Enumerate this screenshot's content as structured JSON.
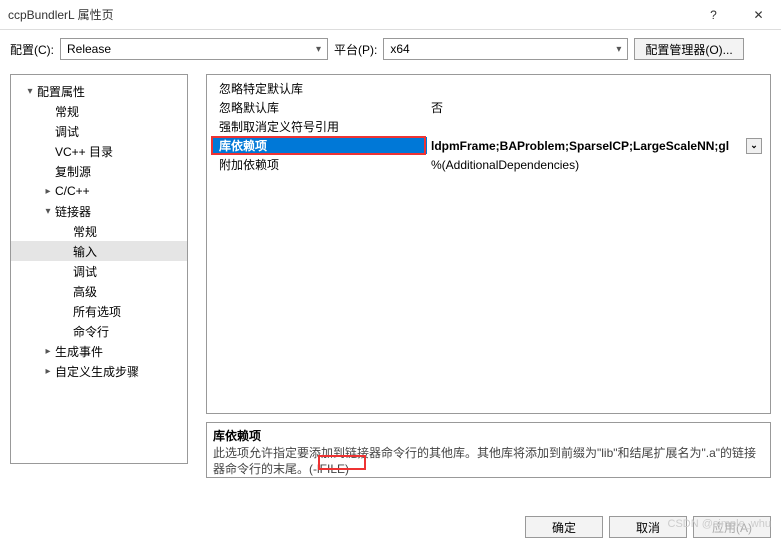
{
  "window": {
    "title": "ccpBundlerL 属性页",
    "help": "?",
    "close": "✕"
  },
  "toolbar": {
    "config_label": "配置(C):",
    "config_value": "Release",
    "platform_label": "平台(P):",
    "platform_value": "x64",
    "manager_btn": "配置管理器(O)..."
  },
  "tree": [
    {
      "label": "配置属性",
      "level": 1,
      "arrow": "▾"
    },
    {
      "label": "常规",
      "level": 2,
      "arrow": ""
    },
    {
      "label": "调试",
      "level": 2,
      "arrow": ""
    },
    {
      "label": "VC++ 目录",
      "level": 2,
      "arrow": ""
    },
    {
      "label": "复制源",
      "level": 2,
      "arrow": ""
    },
    {
      "label": "C/C++",
      "level": 2,
      "arrow": "▸"
    },
    {
      "label": "链接器",
      "level": 2,
      "arrow": "▾"
    },
    {
      "label": "常规",
      "level": 3,
      "arrow": ""
    },
    {
      "label": "输入",
      "level": 3,
      "arrow": "",
      "selected": true
    },
    {
      "label": "调试",
      "level": 3,
      "arrow": ""
    },
    {
      "label": "高级",
      "level": 3,
      "arrow": ""
    },
    {
      "label": "所有选项",
      "level": 3,
      "arrow": ""
    },
    {
      "label": "命令行",
      "level": 3,
      "arrow": ""
    },
    {
      "label": "生成事件",
      "level": 2,
      "arrow": "▸"
    },
    {
      "label": "自定义生成步骤",
      "level": 2,
      "arrow": "▸"
    }
  ],
  "grid": {
    "rows": [
      {
        "key": "忽略特定默认库",
        "val": ""
      },
      {
        "key": "忽略默认库",
        "val": "否"
      },
      {
        "key": "强制取消定义符号引用",
        "val": ""
      },
      {
        "key": "库依赖项",
        "val": "ldpmFrame;BAProblem;SparseICP;LargeScaleNN;gl",
        "selected": true,
        "dd": true
      },
      {
        "key": "附加依赖项",
        "val": "%(AdditionalDependencies)"
      }
    ]
  },
  "desc": {
    "title": "库依赖项",
    "text": "此选项允许指定要添加到链接器命令行的其他库。其他库将添加到前缀为\"lib\"和结尾扩展名为\".a\"的链接器命令行的末尾。(-lFILE)"
  },
  "footer": {
    "ok": "确定",
    "cancel": "取消",
    "apply": "应用(A)"
  },
  "watermark": "CSDN @simple_whu"
}
